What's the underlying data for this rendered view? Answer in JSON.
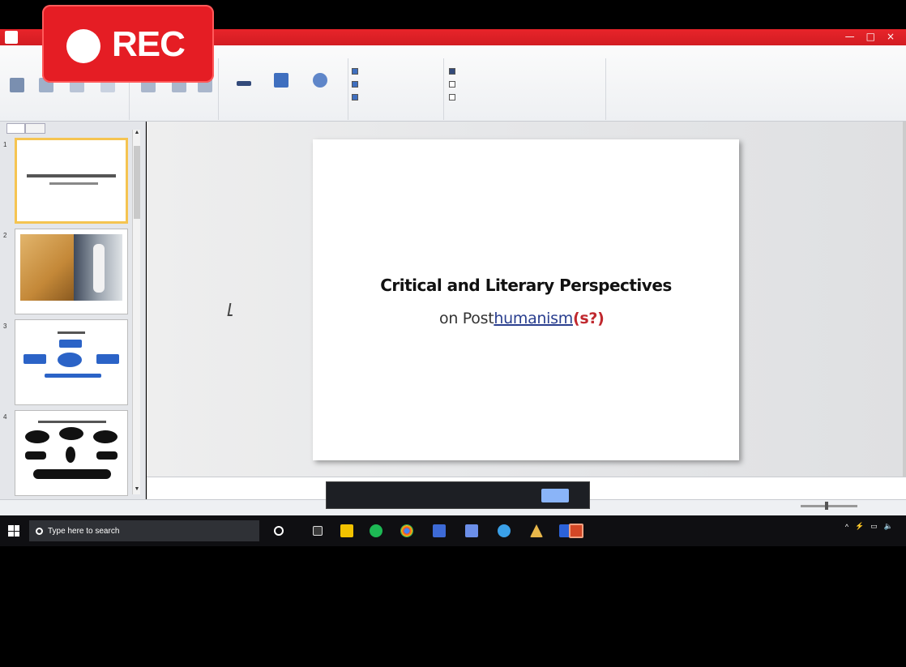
{
  "recording": {
    "label": "REC"
  },
  "window": {
    "controls": [
      "—",
      "□",
      "×"
    ]
  },
  "slide": {
    "title": "Critical and Literary Perspectives",
    "subtitle_prefix": "on Post",
    "subtitle_underlined": "humanism",
    "subtitle_suffix": "(s?)"
  },
  "slide_panel": {
    "slide_numbers": [
      "1",
      "2",
      "3",
      "4"
    ]
  },
  "taskbar": {
    "search_placeholder": "Type here to search"
  },
  "colors": {
    "rec_red": "#e51d24",
    "titlebar_red": "#d21c22",
    "selected_thumbnail": "#f5c451",
    "subtitle_underline": "#2a3f8f",
    "subtitle_accent": "#c0282e",
    "taskbar_bg": "#0f0f12"
  }
}
